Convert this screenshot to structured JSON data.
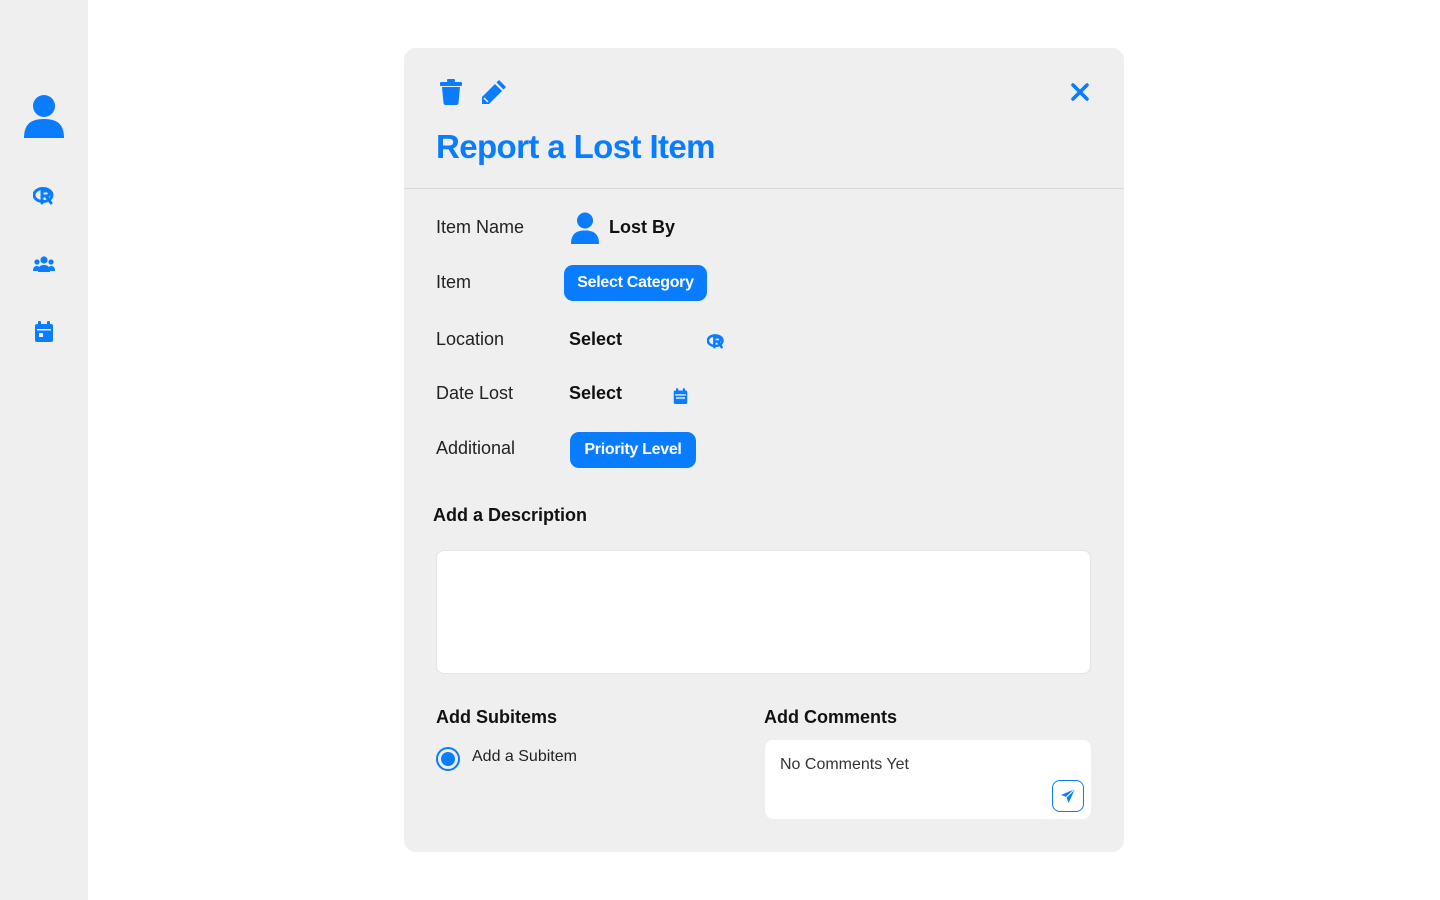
{
  "colors": {
    "accent": "#0a7cff",
    "panel": "#efefef",
    "sidebar": "#efefef"
  },
  "sidebar": {
    "items": [
      {
        "icon": "user-icon"
      },
      {
        "icon": "location-tag-icon"
      },
      {
        "icon": "users-icon"
      },
      {
        "icon": "calendar-icon"
      }
    ]
  },
  "modal": {
    "toolbar": {
      "delete_icon": "trash-icon",
      "edit_icon": "pencil-icon",
      "close_icon": "close-icon"
    },
    "title": "Report a Lost Item",
    "fields": {
      "item_name_label": "Item Name",
      "lost_by_label": "Lost By",
      "item_label": "Item",
      "select_category_button": "Select Category",
      "location_label": "Location",
      "location_value": "Select",
      "date_lost_label": "Date Lost",
      "date_lost_value": "Select",
      "additional_label": "Additional",
      "priority_level_button": "Priority Level"
    },
    "description": {
      "heading": "Add a Description",
      "value": ""
    },
    "subitems": {
      "heading": "Add Subitems",
      "option_label": "Add a Subitem",
      "selected": true
    },
    "comments": {
      "heading": "Add Comments",
      "placeholder": "No Comments Yet",
      "send_icon": "send-icon"
    }
  }
}
